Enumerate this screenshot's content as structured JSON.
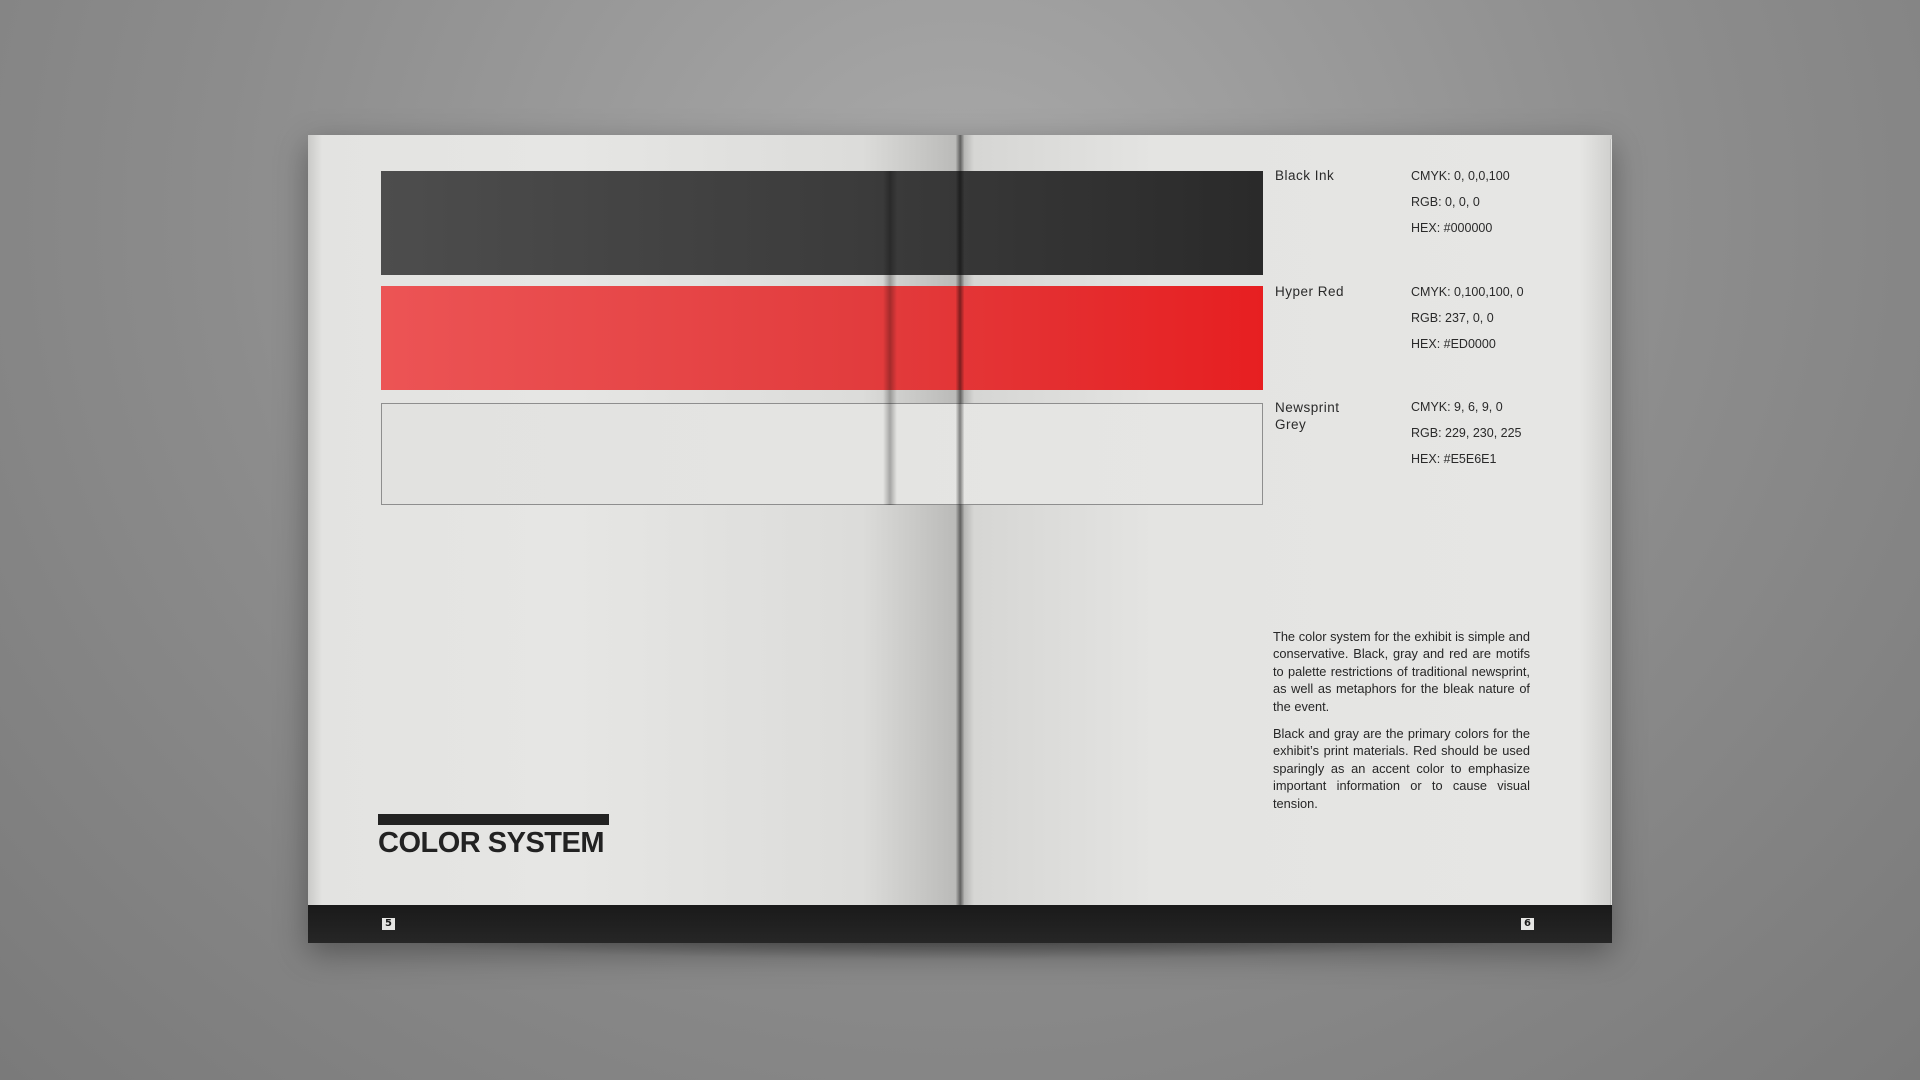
{
  "title": "COLOR SYSTEM",
  "pages": {
    "left_number": "5",
    "right_number": "6"
  },
  "colors": [
    {
      "name": "Black Ink",
      "cmyk": "CMYK: 0, 0,0,100",
      "rgb": "RGB: 0, 0, 0",
      "hex": "HEX: #000000",
      "swatch_color": "#3b3b3b"
    },
    {
      "name": "Hyper Red",
      "cmyk": "CMYK: 0,100,100, 0",
      "rgb": "RGB: 237, 0, 0",
      "hex": "HEX: #ED0000",
      "swatch_color": "#e23c3d"
    },
    {
      "name": "Newsprint Grey",
      "cmyk": "CMYK: 9, 6, 9, 0",
      "rgb": "RGB: 229, 230, 225",
      "hex": "HEX: #E5E6E1",
      "swatch_color": "#e5e6e1"
    }
  ],
  "description": {
    "paragraph1": "The color system for the exhibit is simple and conservative. Black, gray and red are motifs to palette restrictions of traditional newsprint, as well as metaphors for the bleak nature of the event.",
    "paragraph2": "Black and gray are the primary colors for the exhibit’s print materials. Red should be used sparingly as an accent color to emphasize important information or to cause visual tension."
  }
}
